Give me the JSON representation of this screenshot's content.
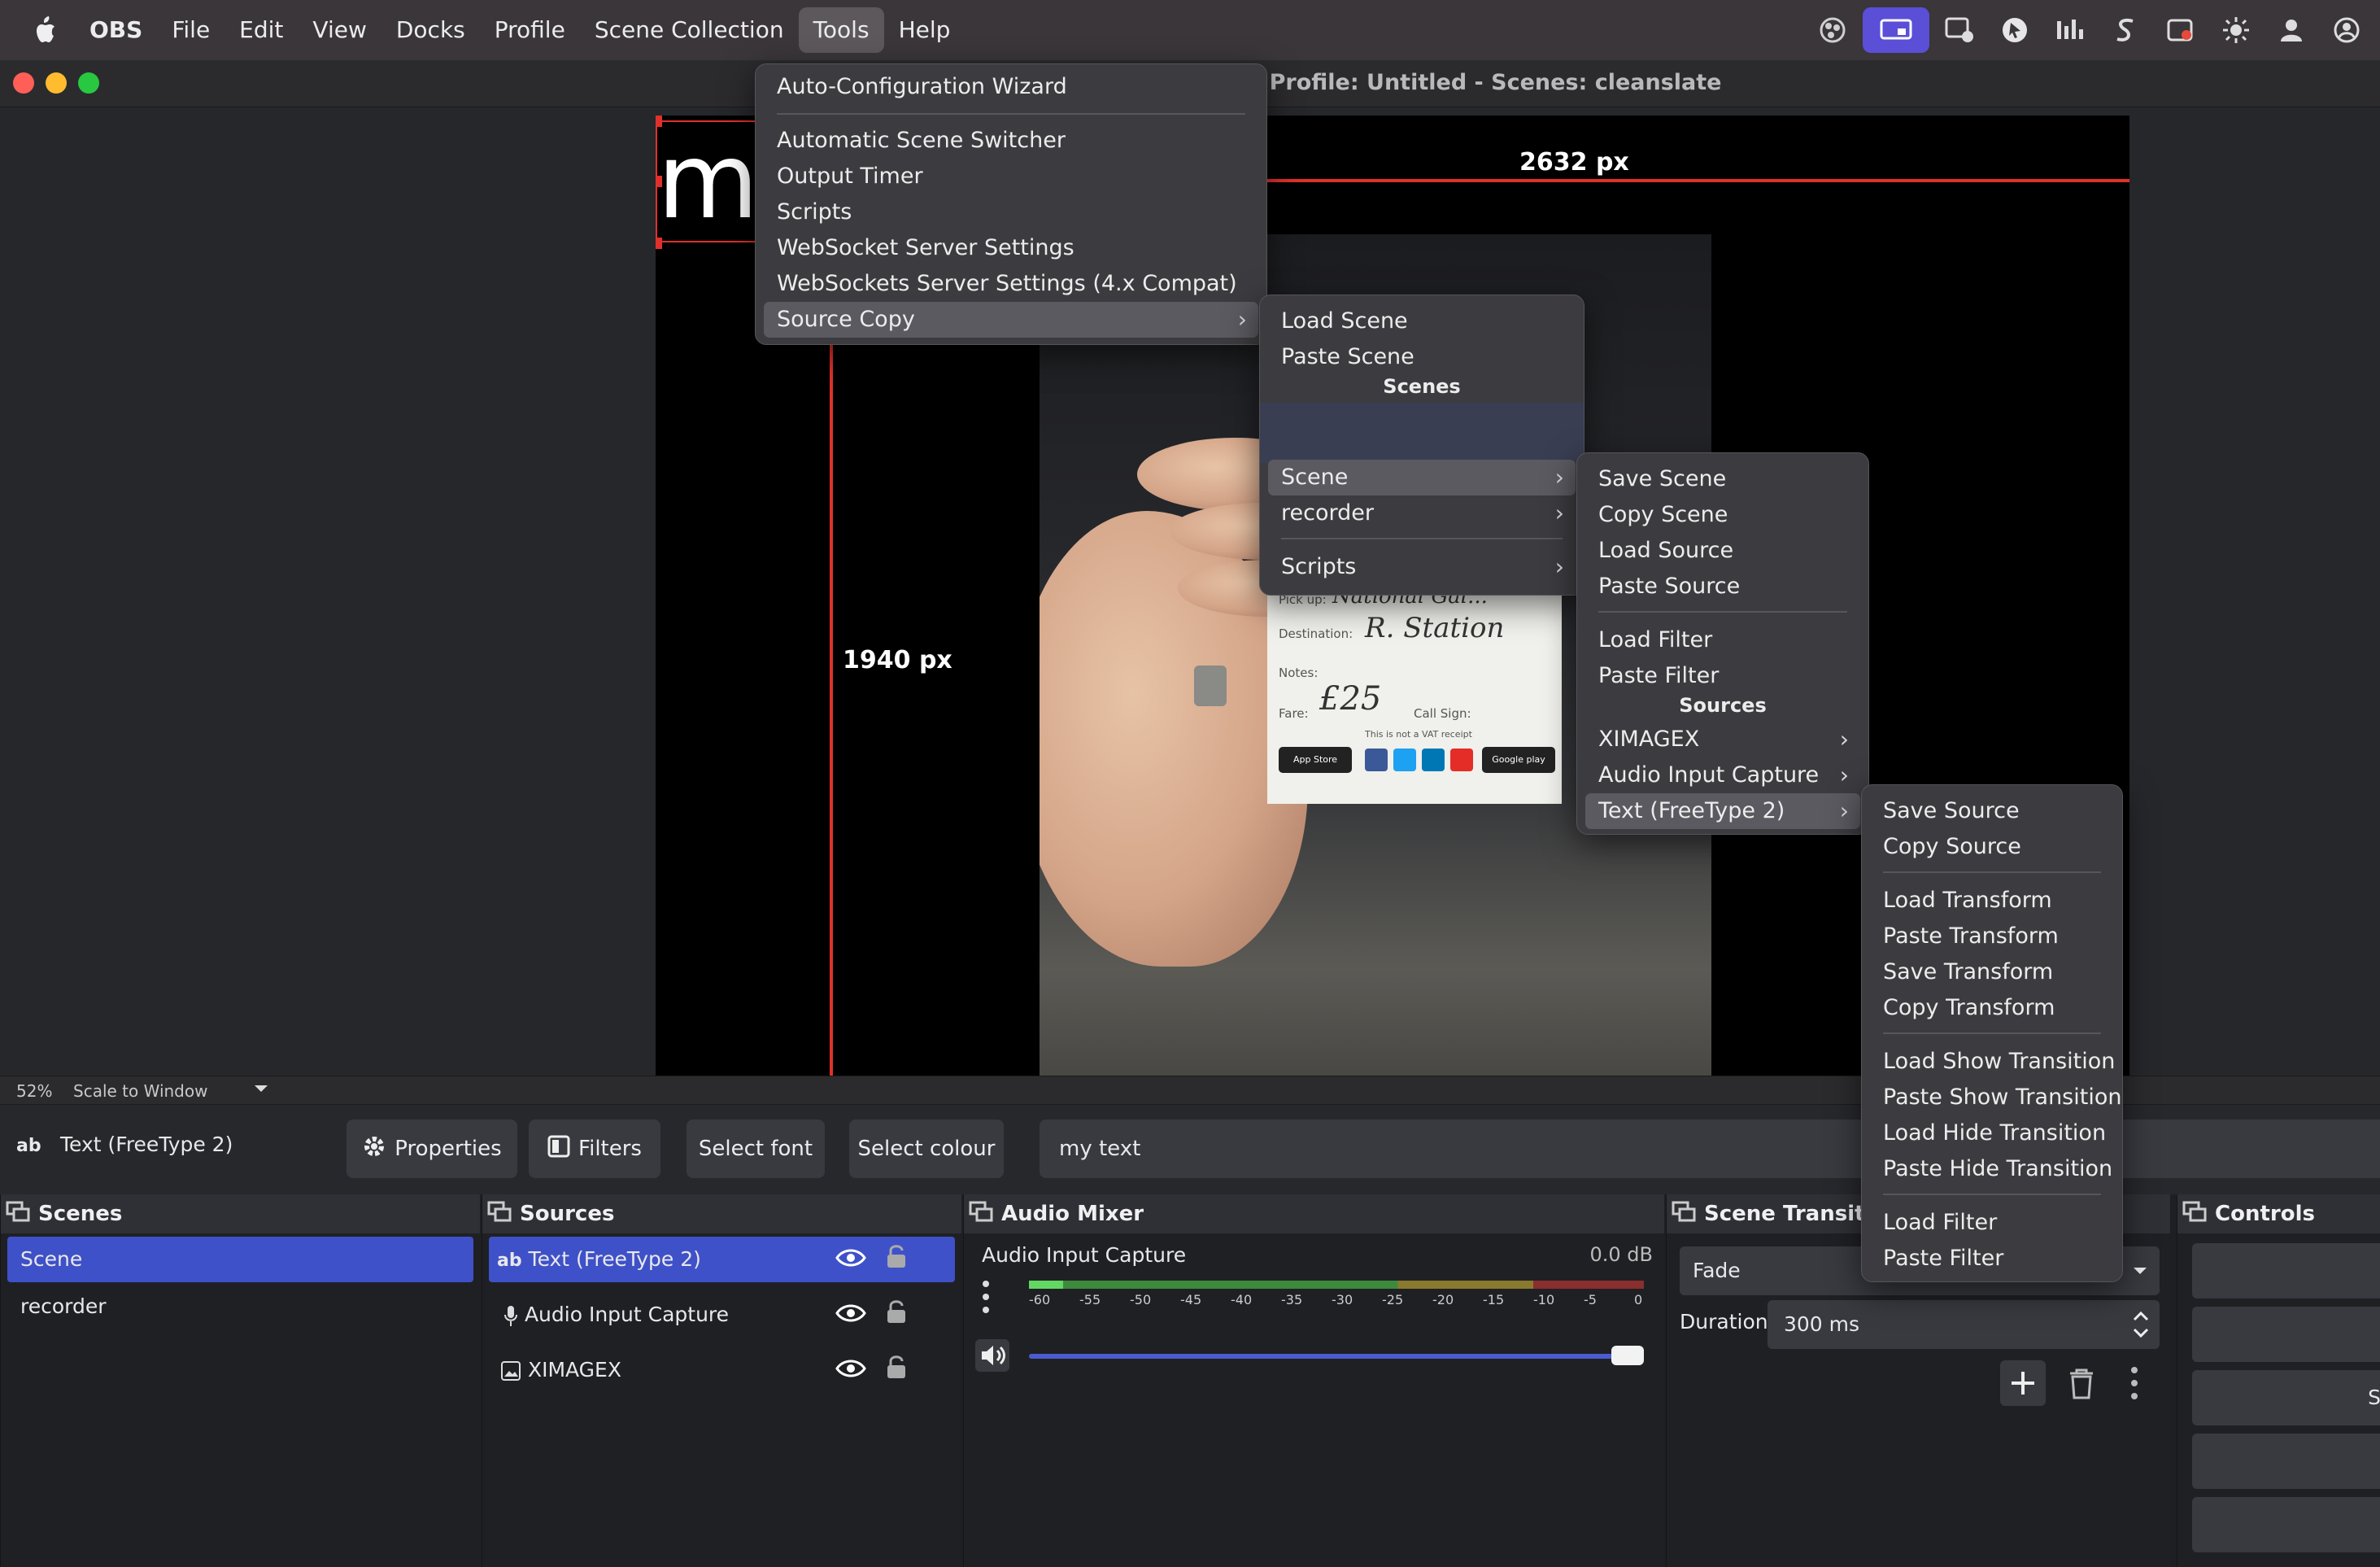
{
  "menubar": {
    "app": "OBS",
    "items": [
      "File",
      "Edit",
      "View",
      "Docks",
      "Profile",
      "Scene Collection",
      "Tools",
      "Help"
    ],
    "active": "Tools",
    "tray_icons": [
      "obs-tray-icon",
      "screen-share-icon",
      "activity-monitor-icon",
      "cursor-icon",
      "stats-icon",
      "scribble-icon",
      "record-icon",
      "brightness-icon",
      "user-icon",
      "account-icon"
    ]
  },
  "window": {
    "title": "- Profile: Untitled - Scenes: cleanslate"
  },
  "preview": {
    "text_source_content": "my",
    "width_label": "2632 px",
    "height_label": "1940 px",
    "receipt": {
      "pickup_label": "Pick up:",
      "pickup_value": "National Gal...",
      "destination_label": "Destination:",
      "destination_value": "R. Station",
      "notes_label": "Notes:",
      "fare_label": "Fare:",
      "fare_value": "£25",
      "callsign_label": "Call Sign:",
      "vat_note": "This is not a VAT receipt",
      "appstore_label": "App Store",
      "googleplay_label": "Google play"
    }
  },
  "status": {
    "zoom": "52%",
    "scale_mode": "Scale to Window"
  },
  "context_bar": {
    "source_icon_label": "ab",
    "source_name": "Text (FreeType 2)",
    "properties": "Properties",
    "filters": "Filters",
    "select_font": "Select font",
    "select_colour": "Select colour",
    "text_value": "my text"
  },
  "docks": {
    "scenes": {
      "title": "Scenes",
      "items": [
        "Scene",
        "recorder"
      ],
      "selected": "Scene"
    },
    "sources": {
      "title": "Sources",
      "items": [
        {
          "icon": "text-icon",
          "label": "Text (FreeType 2)",
          "prefix": "ab"
        },
        {
          "icon": "microphone-icon",
          "label": "Audio Input Capture"
        },
        {
          "icon": "image-icon",
          "label": "XIMAGEX"
        }
      ]
    },
    "audio_mixer": {
      "title": "Audio Mixer",
      "channel": "Audio Input Capture",
      "level": "0.0 dB",
      "scale": [
        "-60",
        "-55",
        "-50",
        "-45",
        "-40",
        "-35",
        "-30",
        "-25",
        "-20",
        "-15",
        "-10",
        "-5",
        "0"
      ],
      "volume_fraction": 1.0
    },
    "scene_transitions": {
      "title": "Scene Transitions",
      "transition": "Fade",
      "duration_label": "Duration",
      "duration_value": "300 ms"
    },
    "controls": {
      "title": "Controls",
      "visible_fragment": "S"
    }
  },
  "menus": {
    "tools": {
      "items": [
        "Auto-Configuration Wizard",
        "Automatic Scene Switcher",
        "Output Timer",
        "Scripts",
        "WebSocket Server Settings",
        "WebSockets Server Settings (4.x Compat)",
        "Source Copy"
      ]
    },
    "source_copy": {
      "items": [
        "Load Scene",
        "Paste Scene"
      ],
      "scenes_header": "Scenes",
      "scene_items": [
        "Scene",
        "recorder",
        "Scripts"
      ]
    },
    "scene_sub": {
      "items": [
        "Save Scene",
        "Copy Scene",
        "Load Source",
        "Paste Source",
        "Load Filter",
        "Paste Filter"
      ],
      "sources_header": "Sources",
      "source_items": [
        "XIMAGEX",
        "Audio Input Capture",
        "Text (FreeType 2)"
      ]
    },
    "text_sub": {
      "items": [
        "Save Source",
        "Copy Source",
        "Load Transform",
        "Paste Transform",
        "Save Transform",
        "Copy Transform",
        "Load Show Transition",
        "Paste Show Transition",
        "Load Hide Transition",
        "Paste Hide Transition",
        "Load Filter",
        "Paste Filter"
      ]
    }
  },
  "colors": {
    "accent": "#3f51c8",
    "red_guide": "#e0302b",
    "tray_highlight": "#5a4fd6"
  }
}
